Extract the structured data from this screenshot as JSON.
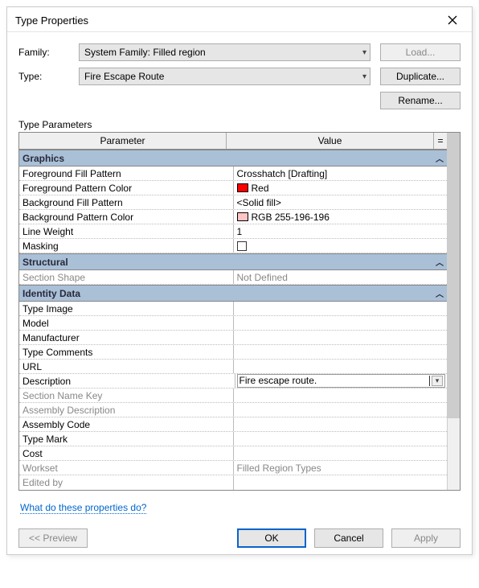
{
  "window": {
    "title": "Type Properties"
  },
  "header": {
    "family_label": "Family:",
    "type_label": "Type:",
    "family_value": "System Family: Filled region",
    "type_value": "Fire Escape Route"
  },
  "buttons": {
    "load": "Load...",
    "duplicate": "Duplicate...",
    "rename": "Rename...",
    "preview": "<< Preview",
    "ok": "OK",
    "cancel": "Cancel",
    "apply": "Apply"
  },
  "grid": {
    "title": "Type Parameters",
    "headers": {
      "param": "Parameter",
      "value": "Value",
      "eq": "="
    },
    "groups": {
      "graphics": "Graphics",
      "structural": "Structural",
      "identity": "Identity Data"
    },
    "rows": {
      "fg_fill_pattern": {
        "label": "Foreground Fill Pattern",
        "value": "Crosshatch [Drafting]"
      },
      "fg_pattern_color": {
        "label": "Foreground Pattern Color",
        "value": "Red",
        "swatch": "#ff0000"
      },
      "bg_fill_pattern": {
        "label": "Background Fill Pattern",
        "value": "<Solid fill>"
      },
      "bg_pattern_color": {
        "label": "Background Pattern Color",
        "value": "RGB 255-196-196",
        "swatch": "#ffc4c4"
      },
      "line_weight": {
        "label": "Line Weight",
        "value": "1"
      },
      "masking": {
        "label": "Masking",
        "checked": false
      },
      "section_shape": {
        "label": "Section Shape",
        "value": "Not Defined",
        "disabled": true
      },
      "type_image": {
        "label": "Type Image",
        "value": ""
      },
      "model": {
        "label": "Model",
        "value": ""
      },
      "manufacturer": {
        "label": "Manufacturer",
        "value": ""
      },
      "type_comments": {
        "label": "Type Comments",
        "value": ""
      },
      "url": {
        "label": "URL",
        "value": ""
      },
      "description": {
        "label": "Description",
        "value": "Fire escape route."
      },
      "section_name_key": {
        "label": "Section Name Key",
        "value": "",
        "disabled": true
      },
      "assembly_desc": {
        "label": "Assembly Description",
        "value": "",
        "disabled": true
      },
      "assembly_code": {
        "label": "Assembly Code",
        "value": ""
      },
      "type_mark": {
        "label": "Type Mark",
        "value": ""
      },
      "cost": {
        "label": "Cost",
        "value": ""
      },
      "workset": {
        "label": "Workset",
        "value": "Filled Region Types",
        "disabled": true
      },
      "edited_by": {
        "label": "Edited by",
        "value": "",
        "disabled": true
      }
    }
  },
  "help_link": "What do these properties do?"
}
